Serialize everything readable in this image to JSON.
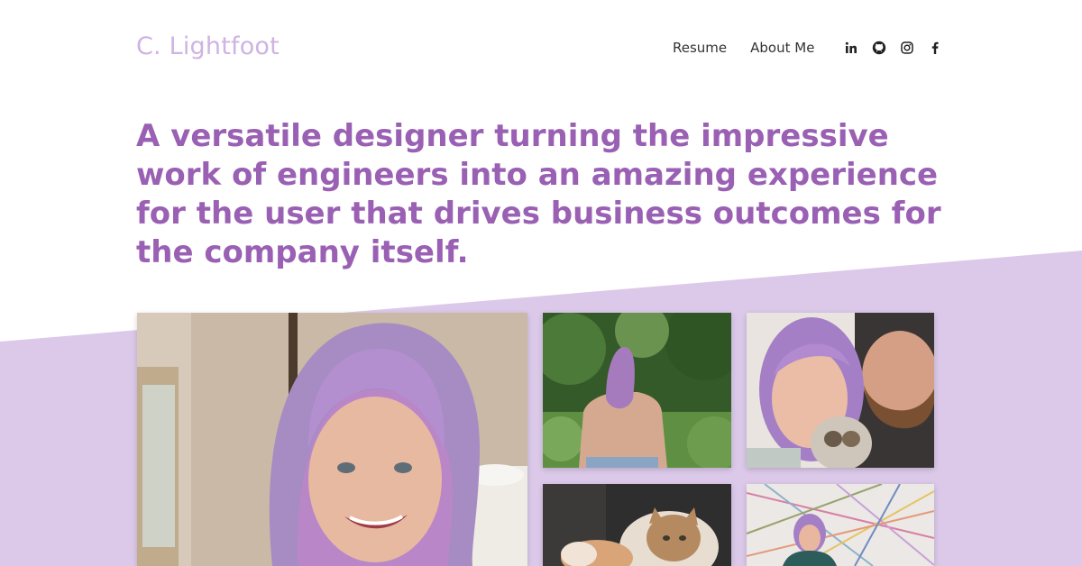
{
  "brand": {
    "name": "C. Lightfoot"
  },
  "nav": {
    "links": [
      "Resume",
      "About Me"
    ],
    "socials": [
      "linkedin-icon",
      "github-icon",
      "instagram-icon",
      "facebook-icon"
    ]
  },
  "hero": {
    "headline": "A versatile designer turning the impressive work of engineers into an amazing experience for the user that drives business outcomes for the company itself."
  },
  "gallery": {
    "photos": [
      "portrait-photo",
      "forest-photo",
      "couple-with-cat-photo",
      "cat-photo",
      "art-wall-photo"
    ]
  },
  "colors": {
    "accent": "#9a60b3",
    "logo": "#cfb3e2",
    "band": "#dcc9e9"
  }
}
